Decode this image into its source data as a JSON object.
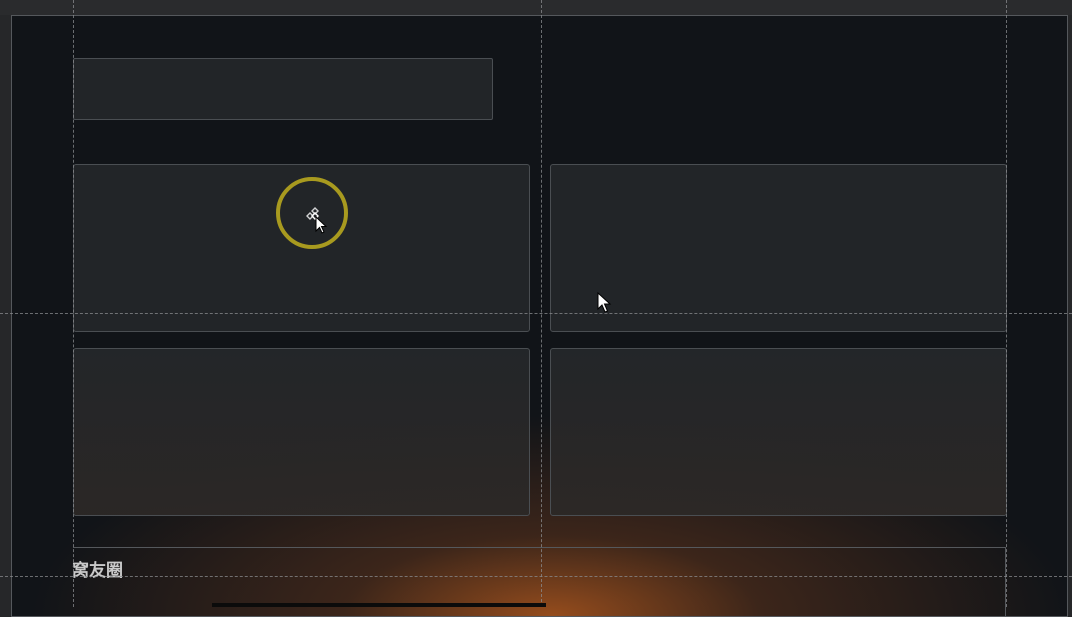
{
  "footer": {
    "label": "窝友圈"
  },
  "cursor": {
    "active_icon": "move-cursor-icon",
    "pointer_icon": "arrow-cursor-icon"
  },
  "colors": {
    "background": "#111418",
    "panel": "#24272a",
    "panel_border": "#4a4e52",
    "click_ring": "#a89a1f",
    "glow": "#cd641e"
  }
}
